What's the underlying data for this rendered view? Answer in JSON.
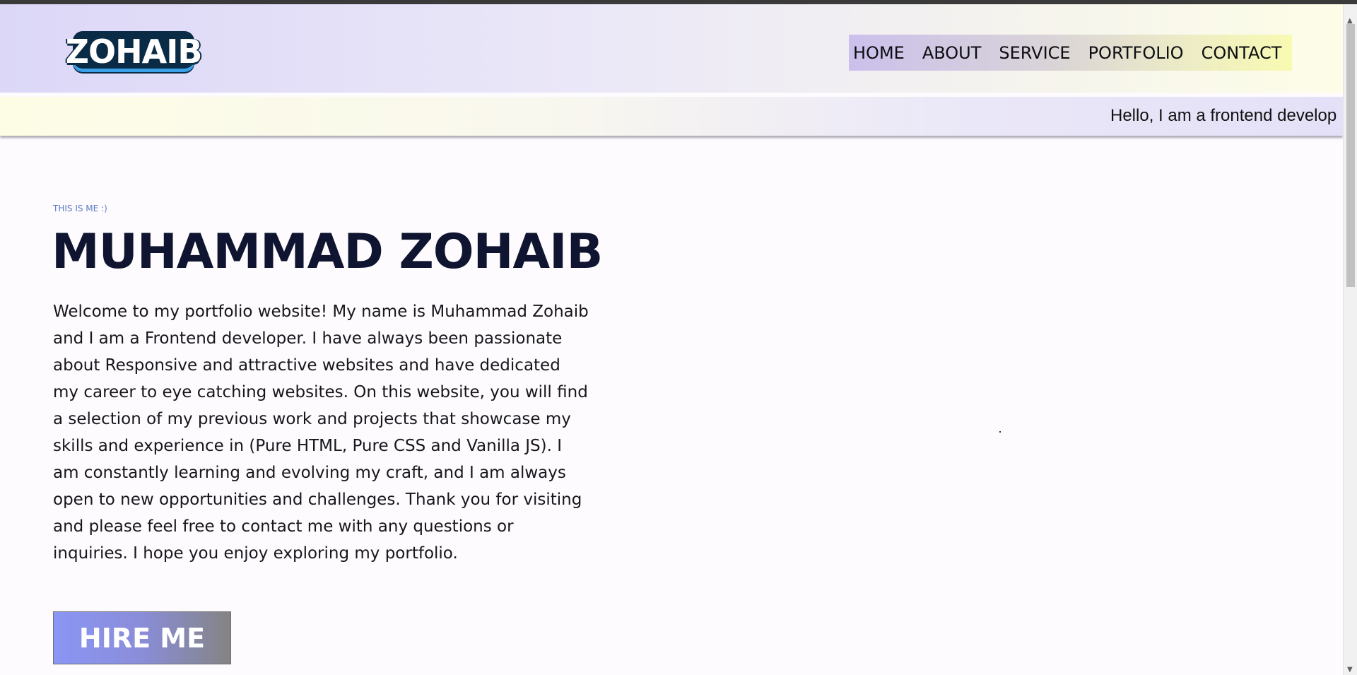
{
  "header": {
    "logo_text": "ZOHAIB",
    "nav": [
      "HOME",
      "ABOUT",
      "SERVICE",
      "PORTFOLIO",
      "CONTACT"
    ]
  },
  "ticker": {
    "text": "Hello, I am a frontend develop"
  },
  "hero": {
    "eyebrow": "THIS IS ME :)",
    "title": "MUHAMMAD ZOHAIB",
    "bio": "Welcome to my portfolio website! My name is Muhammad Zohaib and I am a Frontend developer. I have always been passionate about Responsive and attractive websites and have dedicated my career to eye catching websites. On this website, you will find a selection of my previous work and projects that showcase my skills and experience in (Pure HTML, Pure CSS and Vanilla JS). I am constantly learning and evolving my craft, and I am always open to new opportunities and challenges. Thank you for visiting and please feel free to contact me with any questions or inquiries. I hope you enjoy exploring my portfolio.",
    "cta_label": "HIRE ME"
  },
  "scrollbar": {
    "up_icon": "chevron-up-icon",
    "down_icon": "chevron-down-icon"
  },
  "colors": {
    "title": "#0f1530",
    "eyebrow": "#5b7cc8",
    "cta_start": "#8a96f5",
    "cta_end": "#848484"
  }
}
